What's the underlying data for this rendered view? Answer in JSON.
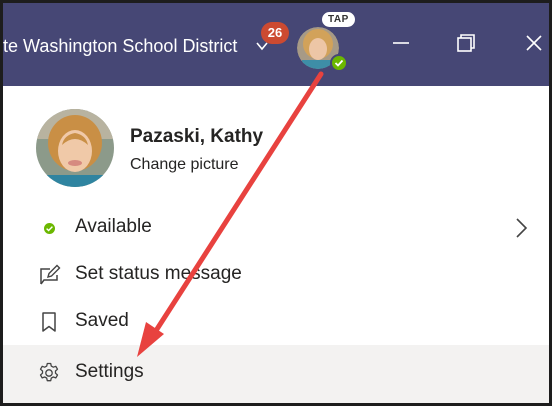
{
  "titlebar": {
    "org_name": "te Washington School District",
    "notification_count": "26",
    "tap_label": "TAP"
  },
  "profile": {
    "name": "Pazaski, Kathy",
    "change_picture": "Change picture"
  },
  "menu": {
    "available": "Available",
    "status_message": "Set status message",
    "saved": "Saved",
    "settings": "Settings"
  },
  "colors": {
    "titlebar": "#464775",
    "badge": "#cc4a31",
    "presence": "#6bb700",
    "arrow": "#e8423f",
    "selected_row": "#f3f2f1"
  },
  "icons": [
    "chevron-down-icon",
    "minimize-icon",
    "maximize-icon",
    "close-icon",
    "chevron-right-icon",
    "edit-status-icon",
    "bookmark-icon",
    "gear-icon"
  ]
}
